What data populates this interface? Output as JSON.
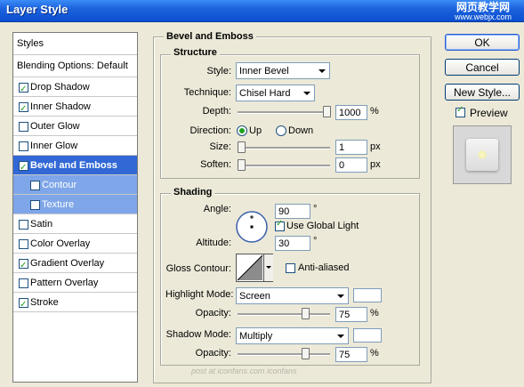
{
  "window": {
    "title": "Layer Style"
  },
  "watermark": {
    "line1": "网页教学网",
    "line2": "www.webjx.com"
  },
  "styles_panel": {
    "header": "Styles",
    "blending": "Blending Options: Default",
    "items": [
      {
        "label": "Drop Shadow",
        "checked": true
      },
      {
        "label": "Inner Shadow",
        "checked": true
      },
      {
        "label": "Outer Glow",
        "checked": false
      },
      {
        "label": "Inner Glow",
        "checked": false
      },
      {
        "label": "Bevel and Emboss",
        "checked": true,
        "selected": true
      },
      {
        "label": "Contour",
        "checked": false,
        "sub": true
      },
      {
        "label": "Texture",
        "checked": false,
        "sub": true
      },
      {
        "label": "Satin",
        "checked": false
      },
      {
        "label": "Color Overlay",
        "checked": false
      },
      {
        "label": "Gradient Overlay",
        "checked": true
      },
      {
        "label": "Pattern Overlay",
        "checked": false
      },
      {
        "label": "Stroke",
        "checked": true
      }
    ]
  },
  "bevel": {
    "section_title": "Bevel and Emboss",
    "structure": {
      "title": "Structure",
      "style_label": "Style:",
      "style_value": "Inner Bevel",
      "technique_label": "Technique:",
      "technique_value": "Chisel Hard",
      "depth_label": "Depth:",
      "depth_value": "1000",
      "depth_unit": "%",
      "depth_level": 1.0,
      "direction_label": "Direction:",
      "direction_up": "Up",
      "direction_down": "Down",
      "size_label": "Size:",
      "size_value": "1",
      "size_unit": "px",
      "size_level": 0.0,
      "soften_label": "Soften:",
      "soften_value": "0",
      "soften_unit": "px",
      "soften_level": 0.0
    },
    "shading": {
      "title": "Shading",
      "angle_label": "Angle:",
      "angle_value": "90",
      "angle_unit": "°",
      "global_light_label": "Use Global Light",
      "global_light_checked": true,
      "altitude_label": "Altitude:",
      "altitude_value": "30",
      "altitude_unit": "°",
      "gloss_label": "Gloss Contour:",
      "anti_aliased_label": "Anti-aliased",
      "anti_aliased_checked": false,
      "highlight_label": "Highlight Mode:",
      "highlight_value": "Screen",
      "highlight_color": "#ffffff",
      "highlight_opacity_label": "Opacity:",
      "highlight_opacity_value": "75",
      "highlight_opacity_unit": "%",
      "highlight_opacity_level": 0.75,
      "shadow_label": "Shadow Mode:",
      "shadow_value": "Multiply",
      "shadow_color": "#ffffff",
      "shadow_opacity_label": "Opacity:",
      "shadow_opacity_value": "75",
      "shadow_opacity_unit": "%",
      "shadow_opacity_level": 0.75
    }
  },
  "buttons": {
    "ok": "OK",
    "cancel": "Cancel",
    "new_style": "New Style..."
  },
  "preview": {
    "label": "Preview",
    "checked": true
  },
  "footer": {
    "credit": "post at iconfans.com  iconfans"
  }
}
